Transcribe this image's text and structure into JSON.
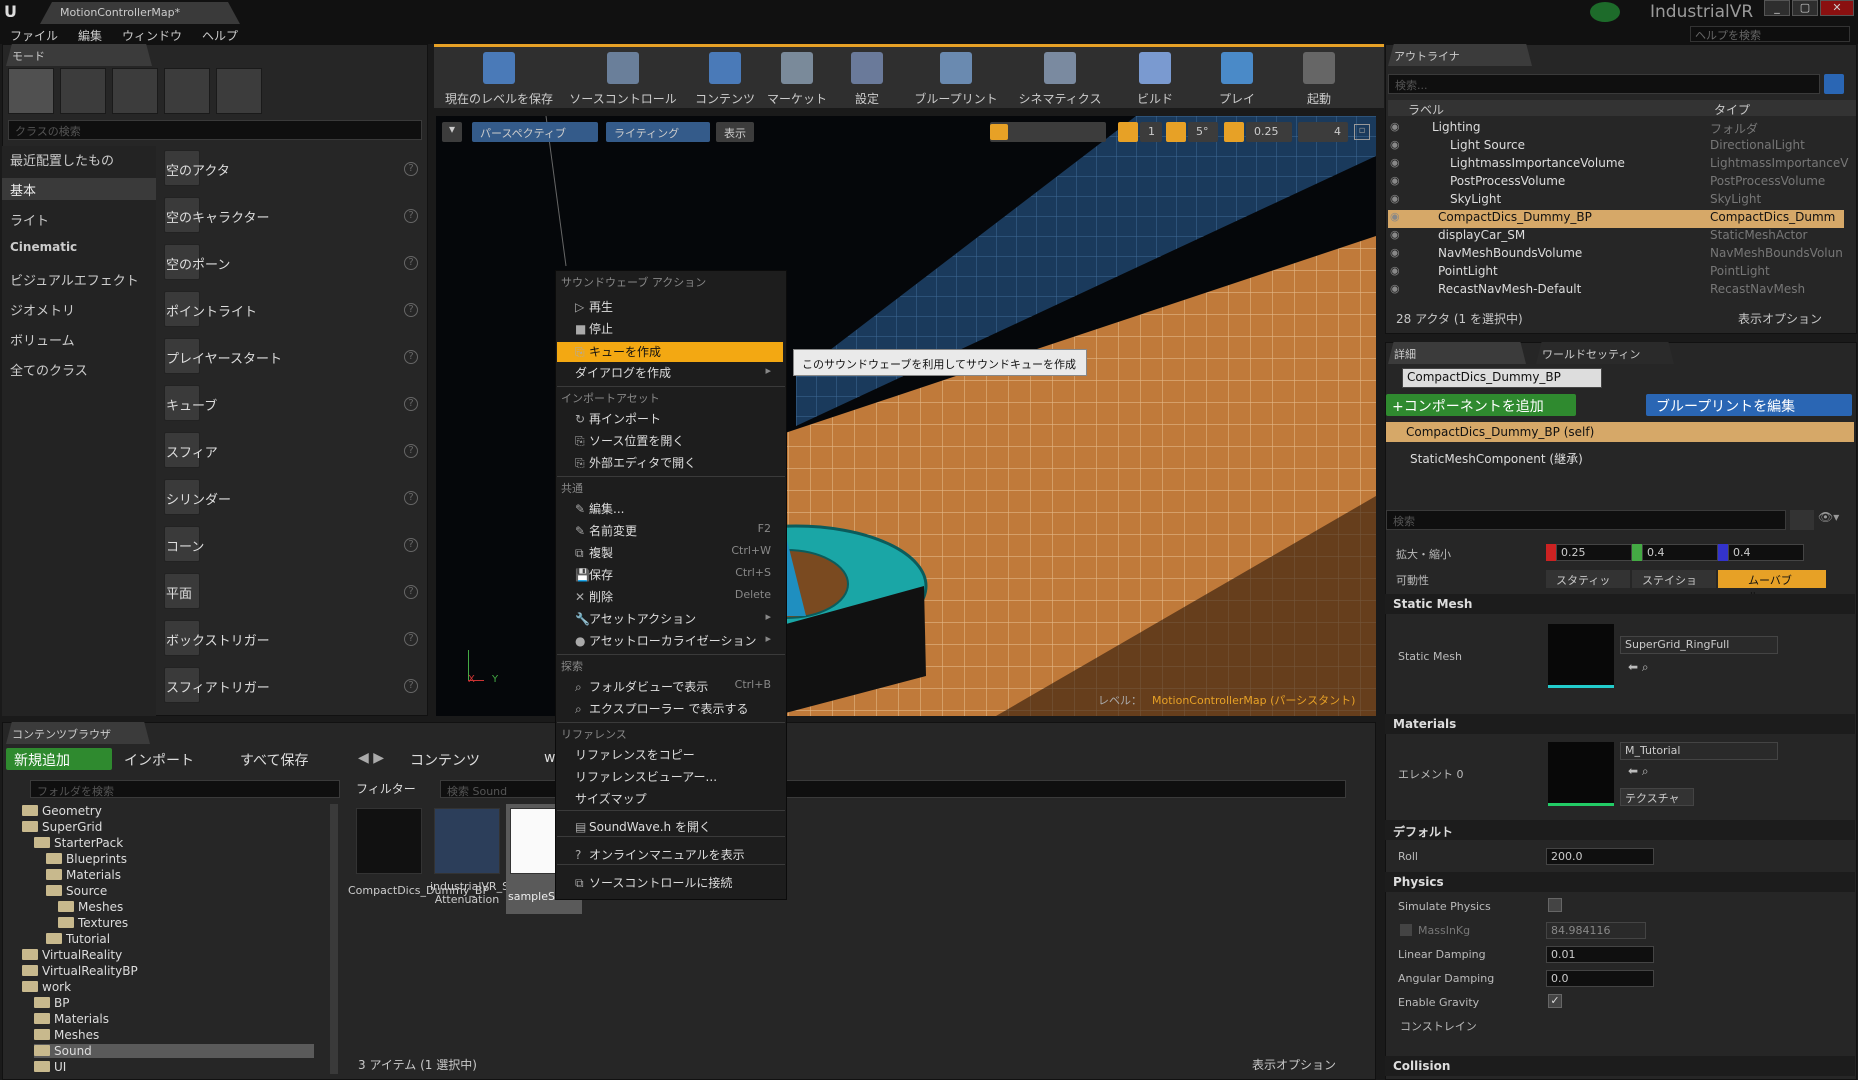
{
  "title": {
    "doc_tab": "MotionControllerMap*",
    "project": "IndustrialVR",
    "help_placeholder": "ヘルプを検索",
    "min": "_",
    "max": "▢",
    "close": "✕"
  },
  "menu": [
    "ファイル",
    "編集",
    "ウィンドウ",
    "ヘルプ"
  ],
  "modes": {
    "tab": "モード",
    "search_placeholder": "クラスの検索",
    "categories": [
      "最近配置したもの",
      "基本",
      "ライト",
      "Cinematic",
      "ビジュアルエフェクト",
      "ジオメトリ",
      "ボリューム",
      "全てのクラス"
    ],
    "items": [
      "空のアクタ",
      "空のキャラクター",
      "空のポーン",
      "ポイントライト",
      "プレイヤースタート",
      "キューブ",
      "スフィア",
      "シリンダー",
      "コーン",
      "平面",
      "ボックストリガー",
      "スフィアトリガー"
    ]
  },
  "toolbar": [
    "現在のレベルを保存",
    "ソースコントロール",
    "コンテンツ",
    "マーケット",
    "設定",
    "ブループリント",
    "シネマティクス",
    "ビルド",
    "プレイ",
    "起動"
  ],
  "viewport": {
    "perspective": "パースペクティブ",
    "lighting": "ライティング",
    "show": "表示",
    "snap1": "1",
    "snap_angle": "5°",
    "snap_scale": "0.25",
    "speed": "4",
    "level_label": "レベル：",
    "level_name": "MotionControllerMap (パーシスタント)",
    "axis_x": "X",
    "axis_y": "Y"
  },
  "context_menu": {
    "h1": "サウンドウェーブ アクション",
    "play": "再生",
    "stop": "停止",
    "create_cue": "キューを作成",
    "create_dialog": "ダイアログを作成",
    "h2": "インポートアセット",
    "reimport": "再インポート",
    "open_source": "ソース位置を開く",
    "open_external": "外部エディタで開く",
    "h3": "共通",
    "edit": "編集...",
    "rename": "名前変更",
    "rename_sc": "F2",
    "duplicate": "複製",
    "duplicate_sc": "Ctrl+W",
    "save": "保存",
    "save_sc": "Ctrl+S",
    "delete": "削除",
    "delete_sc": "Delete",
    "asset_actions": "アセットアクション",
    "asset_loc": "アセットローカライゼーション",
    "h4": "探索",
    "folder_view": "フォルダビューで表示",
    "folder_view_sc": "Ctrl+B",
    "explorer": "エクスプローラー で表示する",
    "h5": "リファレンス",
    "copy_ref": "リファレンスをコピー",
    "ref_viewer": "リファレンスビューアー...",
    "size_map": "サイズマップ",
    "open_h": "SoundWave.h を開く",
    "online_manual": "オンラインマニュアルを表示",
    "source_control": "ソースコントロールに接続"
  },
  "tooltip": "このサウンドウェーブを利用してサウンドキューを作成",
  "outliner": {
    "tab": "アウトライナ",
    "search_placeholder": "検索...",
    "col_label": "ラベル",
    "col_type": "タイプ",
    "rows": [
      {
        "label": "Lighting",
        "type": "フォルダ"
      },
      {
        "label": "Light Source",
        "type": "DirectionalLight"
      },
      {
        "label": "LightmassImportanceVolume",
        "type": "LightmassImportanceV"
      },
      {
        "label": "PostProcessVolume",
        "type": "PostProcessVolume"
      },
      {
        "label": "SkyLight",
        "type": "SkyLight"
      },
      {
        "label": "CompactDics_Dummy_BP",
        "type": "CompactDics_Dumm"
      },
      {
        "label": "displayCar_SM",
        "type": "StaticMeshActor"
      },
      {
        "label": "NavMeshBoundsVolume",
        "type": "NavMeshBoundsVolun"
      },
      {
        "label": "PointLight",
        "type": "PointLight"
      },
      {
        "label": "RecastNavMesh-Default",
        "type": "RecastNavMesh"
      }
    ],
    "status": "28 アクタ (1 を選択中)",
    "view_options": "表示オプション"
  },
  "details": {
    "tab": "詳細",
    "tab2": "ワールドセッティン",
    "name": "CompactDics_Dummy_BP",
    "add_component": "+コンポーネントを追加",
    "edit_bp": "ブループリントを編集",
    "self": "CompactDics_Dummy_BP (self)",
    "component": "StaticMeshComponent (継承)",
    "search_placeholder": "検索",
    "scale_label": "拡大・縮小",
    "scale_x": "0.25",
    "scale_y": "0.4",
    "scale_z": "0.4",
    "mobility_label": "可動性",
    "mob_static": "スタティッ",
    "mob_stationary": "ステイショ",
    "mob_movable": "ムーバブル",
    "sec_static_mesh": "Static Mesh",
    "static_mesh_label": "Static Mesh",
    "static_mesh_value": "SuperGrid_RingFull",
    "sec_materials": "Materials",
    "element0": "エレメント 0",
    "material_value": "M_Tutorial",
    "texture_btn": "テクスチャ",
    "sec_default": "デフォルト",
    "roll_label": "Roll",
    "roll_value": "200.0",
    "sec_physics": "Physics",
    "simulate": "Simulate Physics",
    "mass": "MassInKg",
    "mass_value": "84.984116",
    "lin_damp": "Linear Damping",
    "lin_damp_value": "0.01",
    "ang_damp": "Angular Damping",
    "ang_damp_value": "0.0",
    "gravity": "Enable Gravity",
    "constraint": "コンストレイン",
    "sec_collision": "Collision"
  },
  "content_browser": {
    "tab": "コンテンツブラウザ",
    "add_new": "新規追加",
    "import": "インポート",
    "save_all": "すべて保存",
    "path_root": "コンテンツ",
    "path_next": "w",
    "folder_search": "フォルダを検索",
    "filter": "フィルター",
    "search_placeholder": "検索 Sound",
    "tree": [
      {
        "label": "Geometry",
        "indent": 1
      },
      {
        "label": "SuperGrid",
        "indent": 1
      },
      {
        "label": "StarterPack",
        "indent": 2
      },
      {
        "label": "Blueprints",
        "indent": 3
      },
      {
        "label": "Materials",
        "indent": 3
      },
      {
        "label": "Source",
        "indent": 3
      },
      {
        "label": "Meshes",
        "indent": 4
      },
      {
        "label": "Textures",
        "indent": 4
      },
      {
        "label": "Tutorial",
        "indent": 3
      },
      {
        "label": "VirtualReality",
        "indent": 1
      },
      {
        "label": "VirtualRealityBP",
        "indent": 1
      },
      {
        "label": "work",
        "indent": 1
      },
      {
        "label": "BP",
        "indent": 2
      },
      {
        "label": "Materials",
        "indent": 2
      },
      {
        "label": "Meshes",
        "indent": 2
      },
      {
        "label": "Sound",
        "indent": 2
      },
      {
        "label": "UI",
        "indent": 2
      }
    ],
    "assets": [
      {
        "name": "CompactDics_Dummy_BP"
      },
      {
        "name": "industrialVR_Sound Attenuation"
      },
      {
        "name": "sampleSound"
      }
    ],
    "status": "3 アイテム (1 選択中)",
    "view_options": "表示オプション"
  },
  "colors": {
    "accent": "#e7a126",
    "selection": "#d6a868",
    "green": "#2f8a2f",
    "blue": "#2a66b4"
  }
}
